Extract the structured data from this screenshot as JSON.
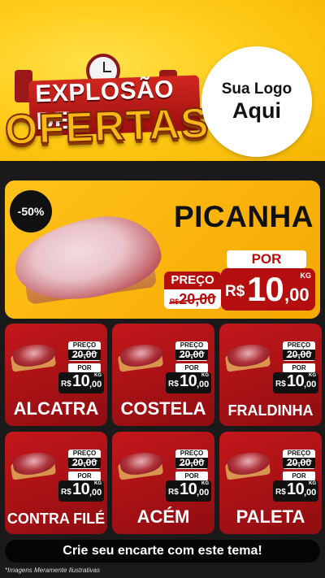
{
  "header": {
    "title_line1": "EXPLOSÃO DE",
    "title_line2": "OFERTAS",
    "logo_line1": "Sua Logo",
    "logo_line2": "Aqui"
  },
  "featured": {
    "discount": "-50%",
    "name": "PICANHA",
    "preco_label": "PREÇO",
    "old_currency": "R$",
    "old_price": "20,00",
    "por_label": "POR",
    "currency": "R$",
    "price_int": "10",
    "price_dec": ",00",
    "unit": "KG"
  },
  "cards": [
    {
      "name": "ALCATRA",
      "preco_label": "PREÇO",
      "old_price": "20,00",
      "por_label": "POR",
      "currency": "R$",
      "price_int": "10",
      "price_dec": ",00",
      "unit": "KG"
    },
    {
      "name": "COSTELA",
      "preco_label": "PREÇO",
      "old_price": "20,00",
      "por_label": "POR",
      "currency": "R$",
      "price_int": "10",
      "price_dec": ",00",
      "unit": "KG"
    },
    {
      "name": "FRALDINHA",
      "preco_label": "PREÇO",
      "old_price": "20,00",
      "por_label": "POR",
      "currency": "R$",
      "price_int": "10",
      "price_dec": ",00",
      "unit": "KG"
    },
    {
      "name": "CONTRA FILÉ",
      "preco_label": "PREÇO",
      "old_price": "20,00",
      "por_label": "POR",
      "currency": "R$",
      "price_int": "10",
      "price_dec": ",00",
      "unit": "KG"
    },
    {
      "name": "ACÉM",
      "preco_label": "PREÇO",
      "old_price": "20,00",
      "por_label": "POR",
      "currency": "R$",
      "price_int": "10",
      "price_dec": ",00",
      "unit": "KG"
    },
    {
      "name": "PALETA",
      "preco_label": "PREÇO",
      "old_price": "20,00",
      "por_label": "POR",
      "currency": "R$",
      "price_int": "10",
      "price_dec": ",00",
      "unit": "KG"
    }
  ],
  "cta": "Crie seu encarte com este tema!",
  "footnote": "*Imagens Meramente Ilustrativas",
  "colors": {
    "header_yellow": "#ffcc1a",
    "featured_yellow": "#ffc21a",
    "card_red": "#c4171b",
    "price_red": "#b50e0e",
    "background": "#1a1a1a"
  }
}
